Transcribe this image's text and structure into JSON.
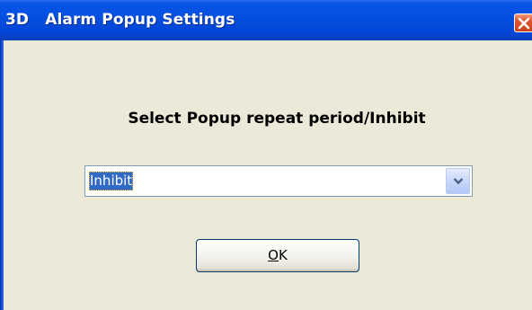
{
  "window": {
    "title": "3D   Alarm Popup Settings"
  },
  "dialog": {
    "prompt": "Select Popup repeat period/Inhibit",
    "dropdown": {
      "selected_value": "Inhibit"
    },
    "ok_button": {
      "mnemonic": "O",
      "rest": "K"
    }
  },
  "colors": {
    "titlebar": "#0450e0",
    "dialog_background": "#ECE9D8",
    "selection_highlight": "#316AC5",
    "close_button": "#e1582f"
  },
  "icons": {
    "close": "close-icon",
    "dropdown": "chevron-down-icon"
  }
}
